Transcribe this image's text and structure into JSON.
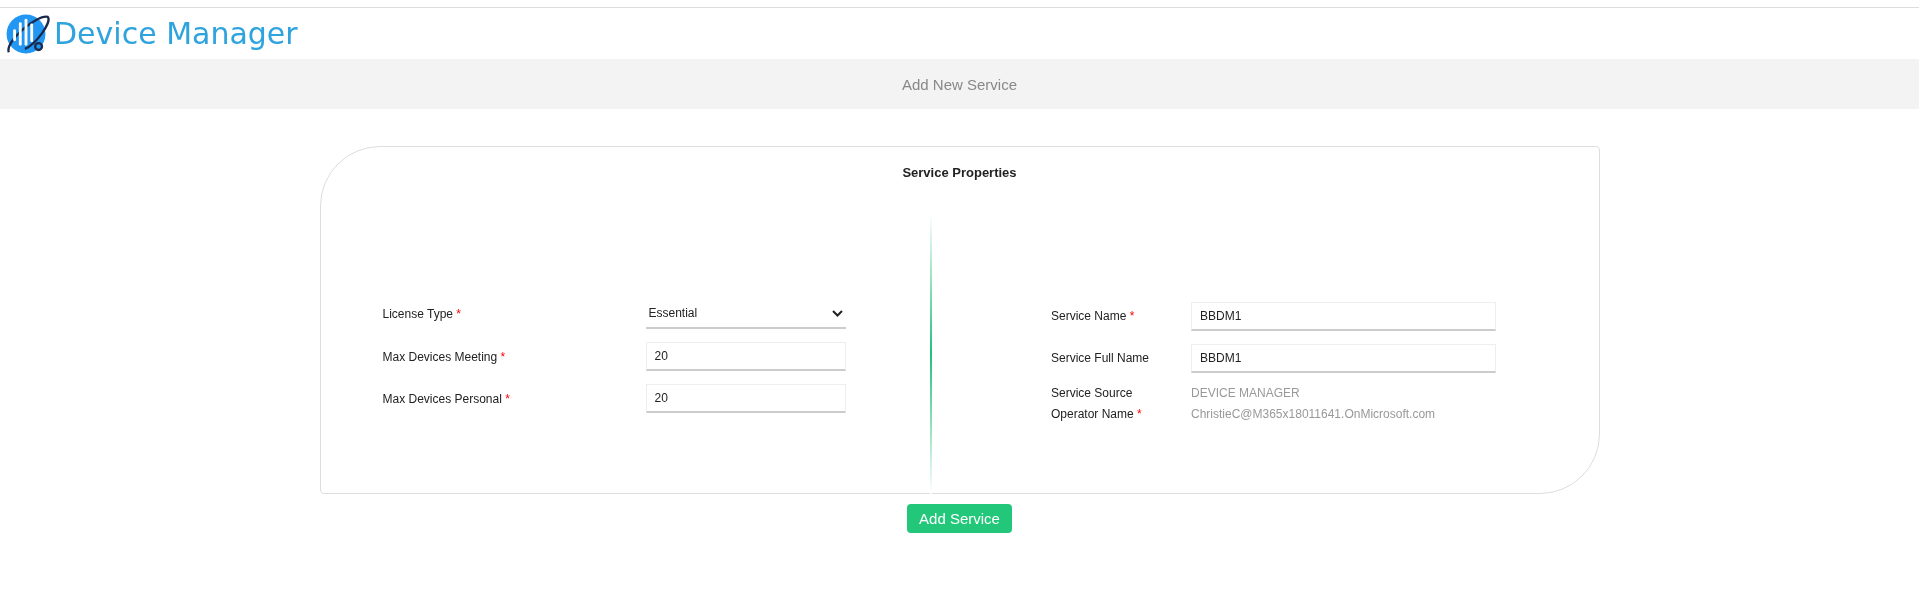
{
  "app": {
    "title": "Device Manager"
  },
  "page_bar": {
    "title": "Add New Service"
  },
  "card": {
    "title": "Service Properties"
  },
  "left_fields": [
    {
      "label": "License Type",
      "required_mark": "*",
      "kind": "select",
      "value": "Essential"
    },
    {
      "label": "Max Devices Meeting",
      "required_mark": "*",
      "kind": "input",
      "value": "20"
    },
    {
      "label": "Max Devices Personal",
      "required_mark": "*",
      "kind": "input",
      "value": "20"
    }
  ],
  "right_fields": [
    {
      "label": "Service Name",
      "required_mark": "*",
      "kind": "input",
      "value": "BBDM1"
    },
    {
      "label": "Service Full Name",
      "kind": "input",
      "value": "BBDM1"
    },
    {
      "label": "Service Source",
      "kind": "readonly",
      "value": "DEVICE MANAGER"
    },
    {
      "label": "Operator Name",
      "required_mark": "*",
      "kind": "readonly",
      "value": "ChristieC@M365x18011641.OnMicrosoft.com"
    }
  ],
  "submit_button": "Add Service"
}
